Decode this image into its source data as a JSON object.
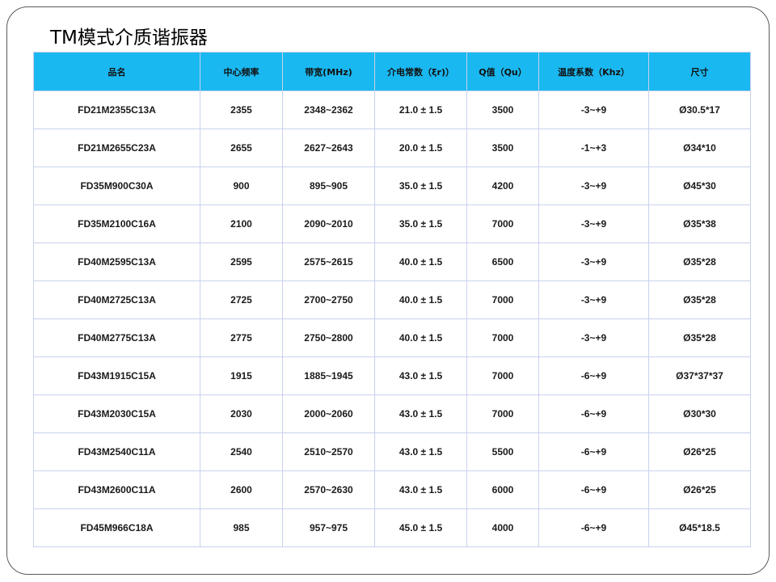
{
  "title": "TM模式介质谐振器",
  "table": {
    "headers": [
      "品名",
      "中心频率",
      "带宽(MHz)",
      "介电常数（ξr)）",
      "Q值（Qu）",
      "温度系数（Khz）",
      "尺寸"
    ],
    "rows": [
      [
        "FD21M2355C13A",
        "2355",
        "2348~2362",
        "21.0 ± 1.5",
        "3500",
        "-3~+9",
        "Ø30.5*17"
      ],
      [
        "FD21M2655C23A",
        "2655",
        "2627~2643",
        "20.0 ± 1.5",
        "3500",
        "-1~+3",
        "Ø34*10"
      ],
      [
        "FD35M900C30A",
        "900",
        "895~905",
        "35.0 ± 1.5",
        "4200",
        "-3~+9",
        "Ø45*30"
      ],
      [
        "FD35M2100C16A",
        "2100",
        "2090~2010",
        "35.0 ± 1.5",
        "7000",
        "-3~+9",
        "Ø35*38"
      ],
      [
        "FD40M2595C13A",
        "2595",
        "2575~2615",
        "40.0 ± 1.5",
        "6500",
        "-3~+9",
        "Ø35*28"
      ],
      [
        "FD40M2725C13A",
        "2725",
        "2700~2750",
        "40.0 ± 1.5",
        "7000",
        "-3~+9",
        "Ø35*28"
      ],
      [
        "FD40M2775C13A",
        "2775",
        "2750~2800",
        "40.0 ± 1.5",
        "7000",
        "-3~+9",
        "Ø35*28"
      ],
      [
        "FD43M1915C15A",
        "1915",
        "1885~1945",
        "43.0 ± 1.5",
        "7000",
        "-6~+9",
        "Ø37*37*37"
      ],
      [
        "FD43M2030C15A",
        "2030",
        "2000~2060",
        "43.0 ± 1.5",
        "7000",
        "-6~+9",
        "Ø30*30"
      ],
      [
        "FD43M2540C11A",
        "2540",
        "2510~2570",
        "43.0 ± 1.5",
        "5500",
        "-6~+9",
        "Ø26*25"
      ],
      [
        "FD43M2600C11A",
        "2600",
        "2570~2630",
        "43.0 ± 1.5",
        "6000",
        "-6~+9",
        "Ø26*25"
      ],
      [
        "FD45M966C18A",
        "985",
        "957~975",
        "45.0 ± 1.5",
        "4000",
        "-6~+9",
        "Ø45*18.5"
      ]
    ]
  },
  "colors": {
    "header_bg": "#1ab8f0",
    "grid_line": "#c7d2ec",
    "frame_border": "#5a5a5a"
  }
}
